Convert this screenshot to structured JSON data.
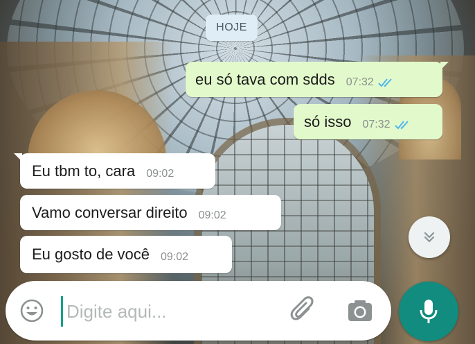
{
  "chat": {
    "date_separator": "HOJE",
    "messages": [
      {
        "direction": "outgoing",
        "text": "eu só tava com sdds",
        "time": "07:32",
        "status": "read"
      },
      {
        "direction": "outgoing",
        "text": "só isso",
        "time": "07:32",
        "status": "read"
      },
      {
        "direction": "incoming",
        "text": "Eu tbm to, cara",
        "time": "09:02"
      },
      {
        "direction": "incoming",
        "text": "Vamo conversar direito",
        "time": "09:02"
      },
      {
        "direction": "incoming",
        "text": "Eu gosto de você",
        "time": "09:02"
      }
    ]
  },
  "composer": {
    "placeholder": "Digite aqui...",
    "value": "",
    "icons": {
      "emoji": "emoji-smiley-icon",
      "attach": "paperclip-icon",
      "camera": "camera-icon",
      "mic": "microphone-icon",
      "scroll": "double-chevron-down-icon"
    }
  },
  "colors": {
    "outgoing_bubble": "#e2f9cb",
    "incoming_bubble": "#ffffff",
    "read_ticks": "#4fb6ec",
    "accent": "#118c7e"
  }
}
